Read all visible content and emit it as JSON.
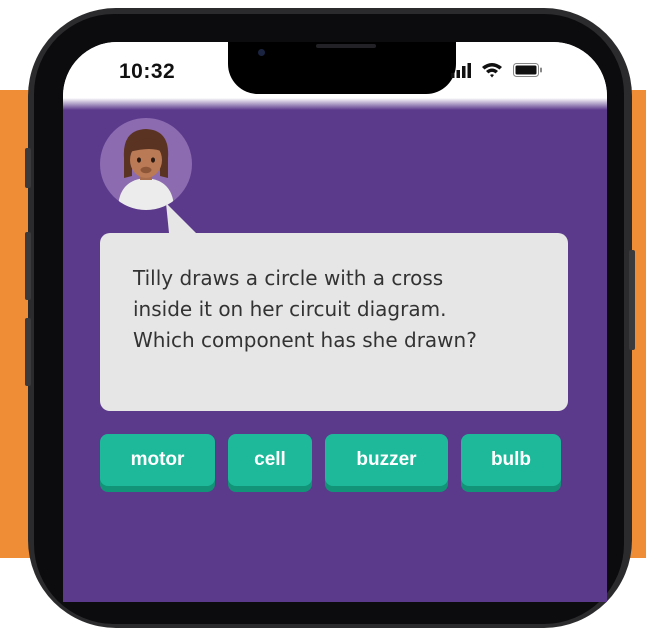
{
  "status_bar": {
    "time": "10:32",
    "icons": [
      "signal-icon",
      "wifi-icon",
      "battery-icon"
    ]
  },
  "character": {
    "avatar_icon": "girl-avatar-icon"
  },
  "question": {
    "text": "Tilly draws a circle with a cross\ninside it on her circuit diagram.\nWhich component has she drawn?"
  },
  "answers": [
    {
      "label": "motor"
    },
    {
      "label": "cell"
    },
    {
      "label": "buzzer"
    },
    {
      "label": "bulb"
    }
  ],
  "colors": {
    "background_orange": "#ee8d35",
    "app_purple": "#5b3a8c",
    "bubble_grey": "#e6e6e6",
    "answer_green": "#1db99a",
    "answer_shadow": "#119477"
  }
}
